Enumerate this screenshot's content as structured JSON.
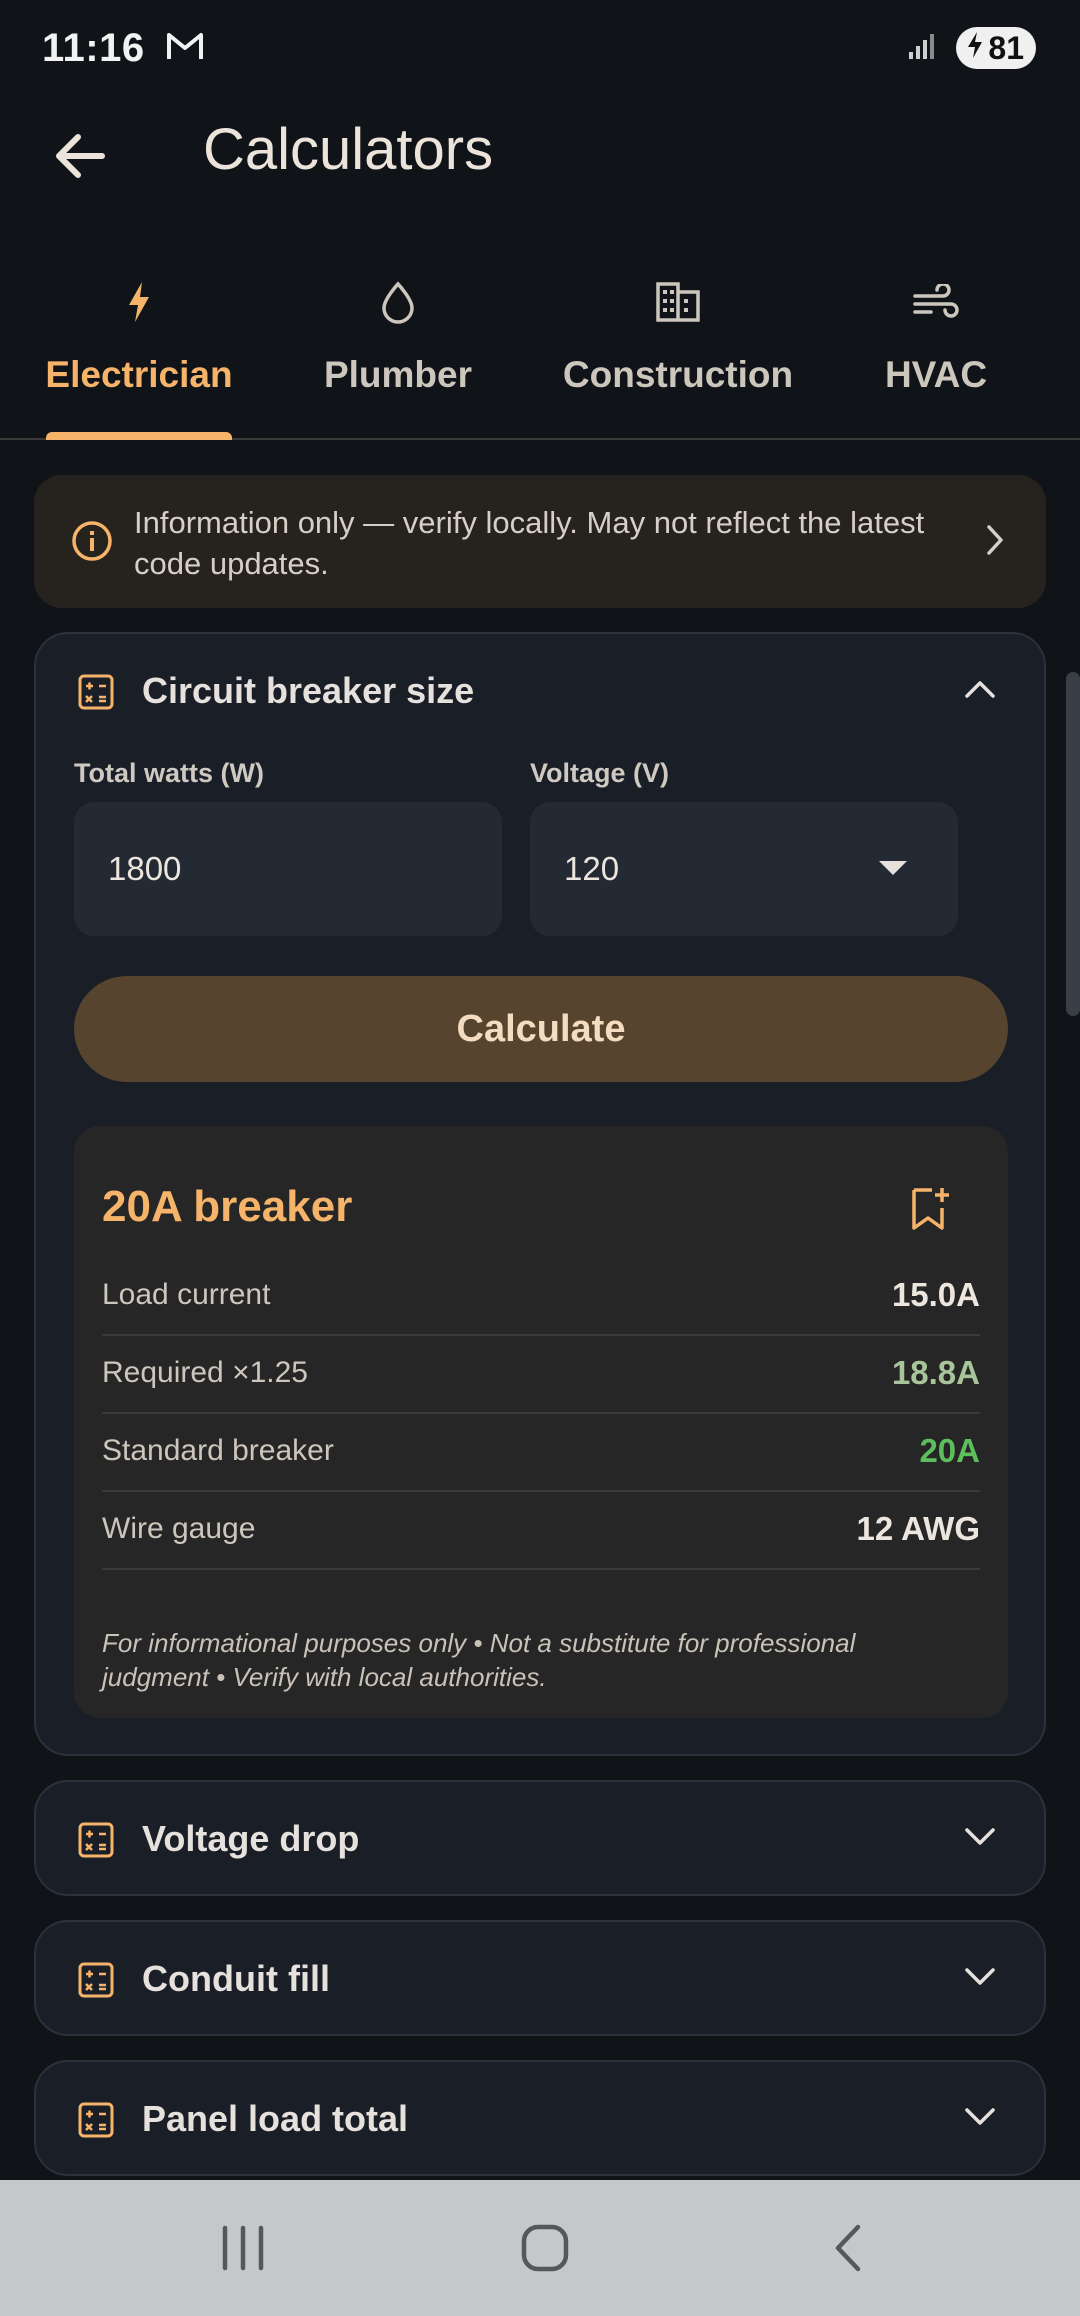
{
  "status": {
    "time": "11:16",
    "battery": "81",
    "icons": [
      "gmail-icon",
      "signal-icon",
      "battery-charging-icon"
    ]
  },
  "app_bar": {
    "title": "Calculators",
    "back_icon": "arrow-back-icon"
  },
  "tabs": [
    {
      "label": "Electrician",
      "icon": "bolt-icon",
      "active": true
    },
    {
      "label": "Plumber",
      "icon": "water-drop-icon",
      "active": false
    },
    {
      "label": "Construction",
      "icon": "building-icon",
      "active": false
    },
    {
      "label": "HVAC",
      "icon": "air-icon",
      "active": false
    }
  ],
  "info_banner": {
    "text": "Information only — verify locally. May not reflect the latest code updates.",
    "icon": "info-icon"
  },
  "circuit_breaker": {
    "title": "Circuit breaker size",
    "watts_label": "Total watts (W)",
    "watts_value": "1800",
    "voltage_label": "Voltage (V)",
    "voltage_value": "120",
    "calculate_label": "Calculate",
    "result": {
      "title": "20A breaker",
      "rows": [
        {
          "label": "Load current",
          "value": "15.0A"
        },
        {
          "label": "Required ×1.25",
          "value": "18.8A"
        },
        {
          "label": "Standard breaker",
          "value": "20A"
        },
        {
          "label": "Wire gauge",
          "value": "12 AWG"
        }
      ],
      "note": "For informational purposes only • Not a substitute for professional judgment • Verify with local authorities."
    }
  },
  "collapsed_cards": [
    {
      "title": "Voltage drop"
    },
    {
      "title": "Conduit fill"
    },
    {
      "title": "Panel load total"
    }
  ],
  "colors": {
    "accent": "#f6b46a",
    "background": "#101419",
    "card": "#1a1f27",
    "required_value": "#a8c49a",
    "standard_breaker_value": "#5cbf5c"
  }
}
